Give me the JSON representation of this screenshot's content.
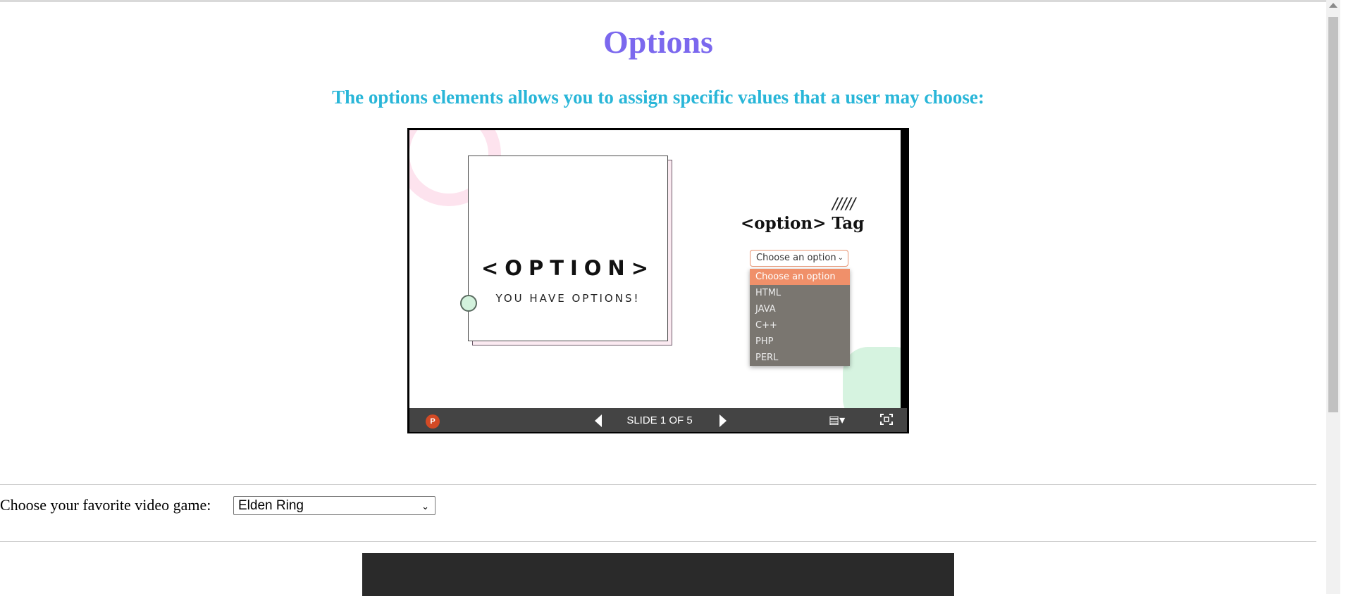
{
  "page": {
    "title": "Options",
    "subtitle": "The options elements allows you to assign specific values that a user may choose:"
  },
  "slide": {
    "card_title": "<OPTION>",
    "card_subtitle": "YOU HAVE OPTIONS!",
    "slashes": "/////",
    "tag_heading": "<option> Tag",
    "select_value": "Choose an option",
    "options": [
      "Choose an option",
      "HTML",
      "JAVA",
      "C++",
      "PHP",
      "PERL"
    ],
    "selected_option": "Choose an option"
  },
  "viewer_toolbar": {
    "app_icon_letter": "P",
    "slide_counter": "SLIDE 1 OF 5"
  },
  "form": {
    "label": "Choose your favorite video game:",
    "select_value": "Elden Ring"
  },
  "colors": {
    "title": "#7b68ee",
    "subtitle": "#29b6d8",
    "selected_option_bg": "#f0906a",
    "toolbar_bg": "#444444"
  },
  "icons": [
    "powerpoint-icon",
    "prev-slide-icon",
    "next-slide-icon",
    "notes-icon",
    "fullscreen-icon",
    "chevron-down-icon"
  ]
}
